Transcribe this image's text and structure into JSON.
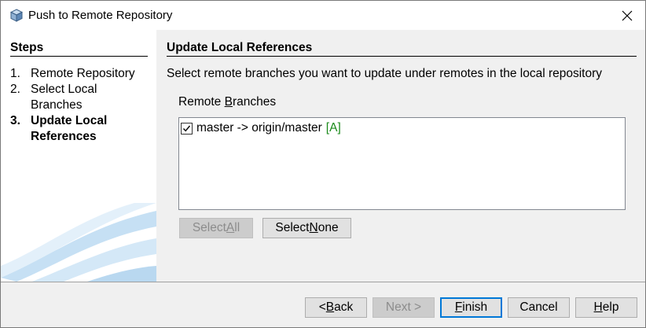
{
  "window": {
    "title": "Push to Remote Repository",
    "app_icon": "netbeans-cube-icon",
    "close_icon": "close-icon"
  },
  "steps": {
    "heading": "Steps",
    "items": [
      {
        "num": "1.",
        "label": "Remote Repository",
        "current": false
      },
      {
        "num": "2.",
        "label": "Select Local Branches",
        "current": false
      },
      {
        "num": "3.",
        "label": "Update Local References",
        "current": true
      }
    ]
  },
  "content": {
    "title": "Update Local References",
    "description": "Select remote branches you want to update under remotes in the local repository",
    "remote_branches_label_pre": "Remote ",
    "remote_branches_label_mnemonic": "B",
    "remote_branches_label_post": "ranches",
    "branches": [
      {
        "text": "master -> origin/master",
        "tag": "[A]",
        "checked": true
      }
    ],
    "select_all": {
      "pre": "Select ",
      "mnemonic": "A",
      "post": "ll",
      "enabled": false
    },
    "select_none": {
      "pre": "Select ",
      "mnemonic": "N",
      "post": "one",
      "enabled": true
    }
  },
  "footer": {
    "back": {
      "pre": "< ",
      "mnemonic": "B",
      "post": "ack"
    },
    "next": {
      "label": "Next >",
      "enabled": false
    },
    "finish": {
      "mnemonic": "F",
      "post": "inish",
      "default": true
    },
    "cancel": {
      "label": "Cancel"
    },
    "help": {
      "mnemonic": "H",
      "post": "elp"
    }
  },
  "colors": {
    "tag_green": "#1a8a1a",
    "default_button_border": "#0078d7"
  }
}
